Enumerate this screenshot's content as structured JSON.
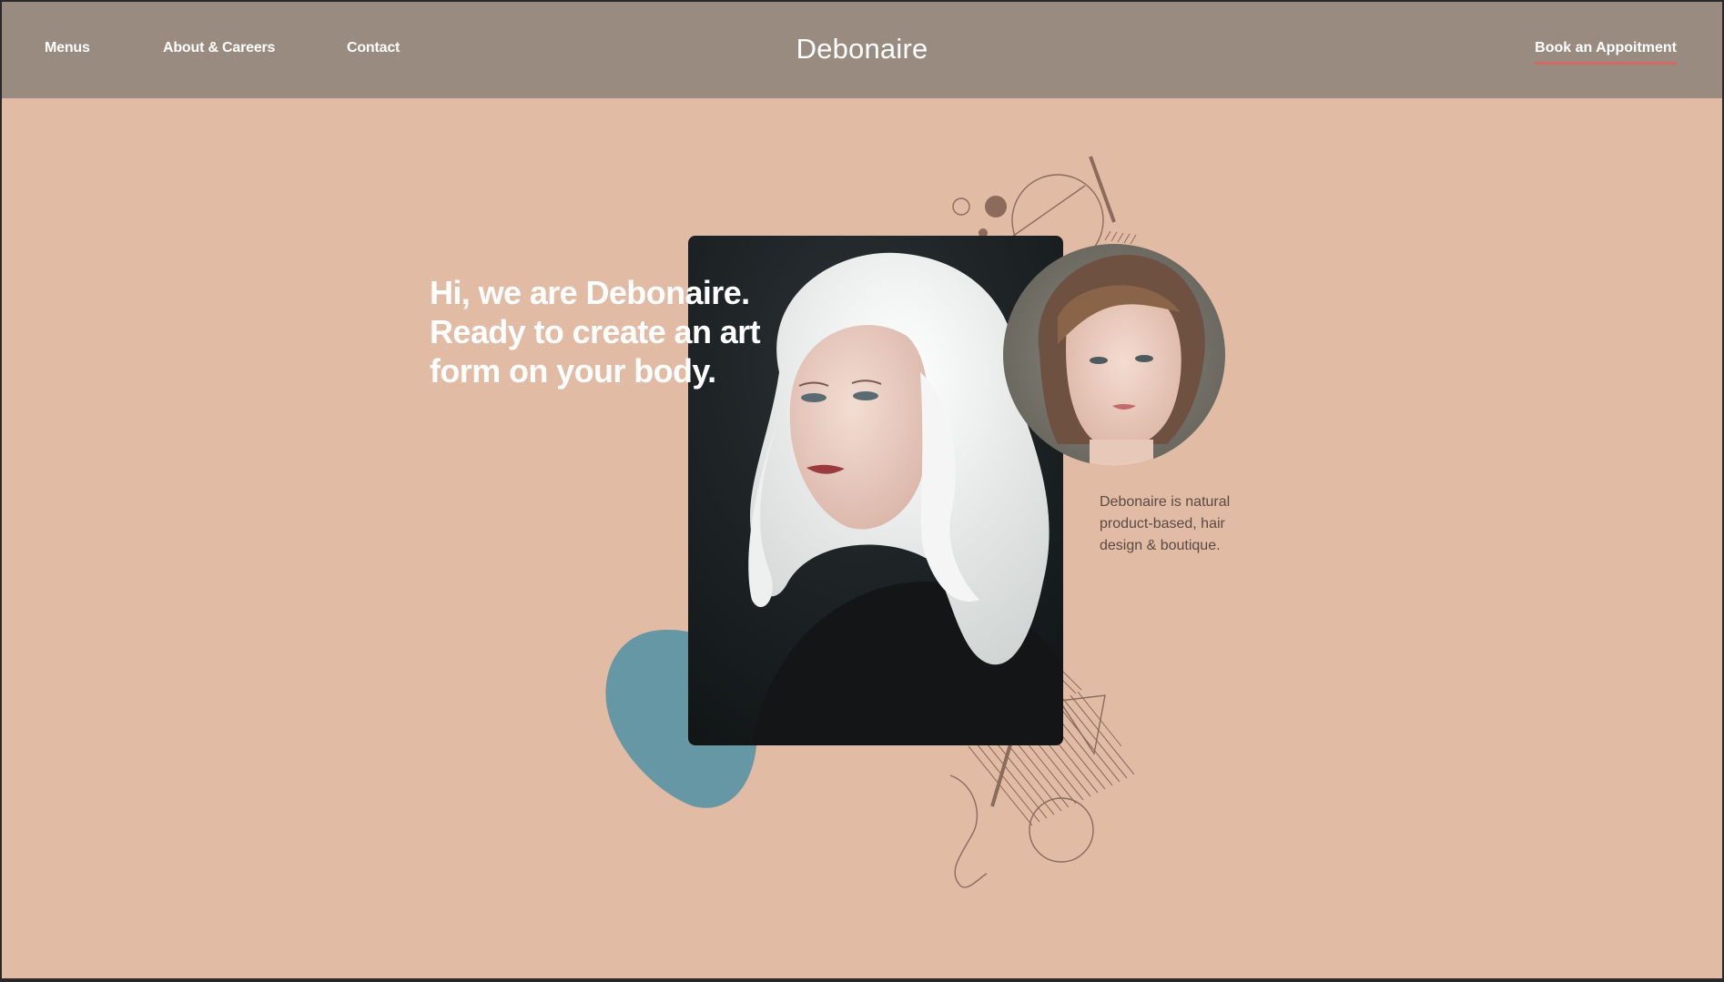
{
  "nav": {
    "links": [
      {
        "label": "Menus"
      },
      {
        "label": "About & Careers"
      },
      {
        "label": "Contact"
      }
    ],
    "brand": "Debonaire",
    "cta_label": "Book an Appoitment"
  },
  "hero": {
    "headline": "Hi, we are Debonaire. Ready to create an art form on your body.",
    "blurb": "Debonaire is natural product-based, hair design & boutique."
  },
  "colors": {
    "background": "#e2bba5",
    "navbar": "#998b80",
    "accent_underline": "#cf6b62",
    "blob": "#6697a4",
    "line_art": "#8c6a5c"
  }
}
